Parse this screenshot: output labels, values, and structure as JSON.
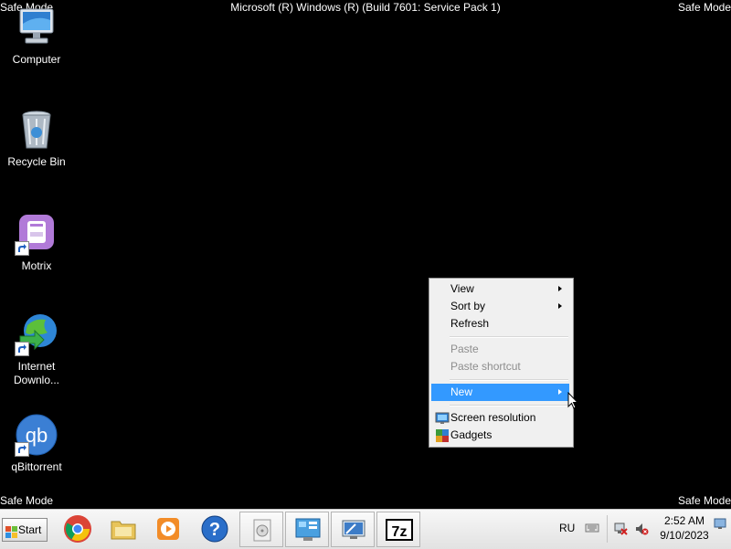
{
  "banner": {
    "safe_mode": "Safe Mode",
    "os_title": "Microsoft (R) Windows (R) (Build 7601: Service Pack 1)"
  },
  "desktop_icons": [
    {
      "label": "Computer",
      "icon": "computer-icon"
    },
    {
      "label": "Recycle Bin",
      "icon": "recycle-bin-icon"
    },
    {
      "label": "Motrix",
      "icon": "motrix-icon"
    },
    {
      "label": "Internet Downlo...",
      "icon": "internet-download-manager-icon"
    },
    {
      "label": "qBittorrent",
      "icon": "qbittorrent-icon"
    }
  ],
  "context_menu": {
    "items": [
      {
        "label": "View",
        "submenu": true,
        "enabled": true
      },
      {
        "label": "Sort by",
        "submenu": true,
        "enabled": true
      },
      {
        "label": "Refresh",
        "submenu": false,
        "enabled": true
      },
      {
        "label": "Paste",
        "submenu": false,
        "enabled": false
      },
      {
        "label": "Paste shortcut",
        "submenu": false,
        "enabled": false
      },
      {
        "label": "New",
        "submenu": true,
        "enabled": true,
        "highlighted": true
      },
      {
        "label": "Screen resolution",
        "submenu": false,
        "enabled": true,
        "icon": "screen-resolution-icon"
      },
      {
        "label": "Gadgets",
        "submenu": false,
        "enabled": true,
        "icon": "gadgets-icon"
      }
    ]
  },
  "taskbar": {
    "start_label": "Start",
    "pinned": [
      "chrome-icon",
      "explorer-icon",
      "media-player-icon",
      "help-icon",
      "disc-icon",
      "control-panel-icon",
      "remote-desktop-icon",
      "7zip-icon"
    ],
    "seven_zip_label": "7z",
    "language": "RU",
    "clock_time": "2:52 AM",
    "clock_date": "9/10/2023"
  },
  "colors": {
    "desktop": "#000000",
    "menu_highlight": "#3399ff",
    "menu_bg": "#f0f0f0",
    "disabled_text": "#8d8d8d"
  }
}
